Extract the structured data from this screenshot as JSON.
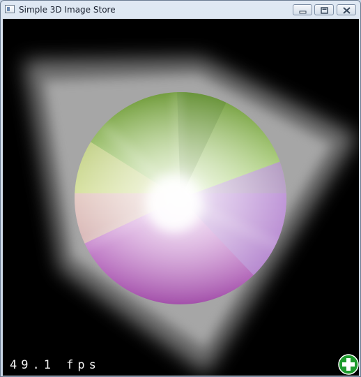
{
  "window": {
    "title": "Simple 3D Image Store",
    "controls": {
      "minimize": "minimize",
      "maximize": "maximize",
      "close": "close"
    }
  },
  "viewport": {
    "background": "#000000",
    "fps_text": "49.1 fps"
  },
  "icons": {
    "app": "app-icon",
    "add": "add-icon"
  },
  "colors": {
    "accent_green": "#1f9b2e",
    "sphere_green": "#9bc95a",
    "sphere_magenta": "#c25fcb",
    "sphere_lilac": "#b892d4"
  }
}
